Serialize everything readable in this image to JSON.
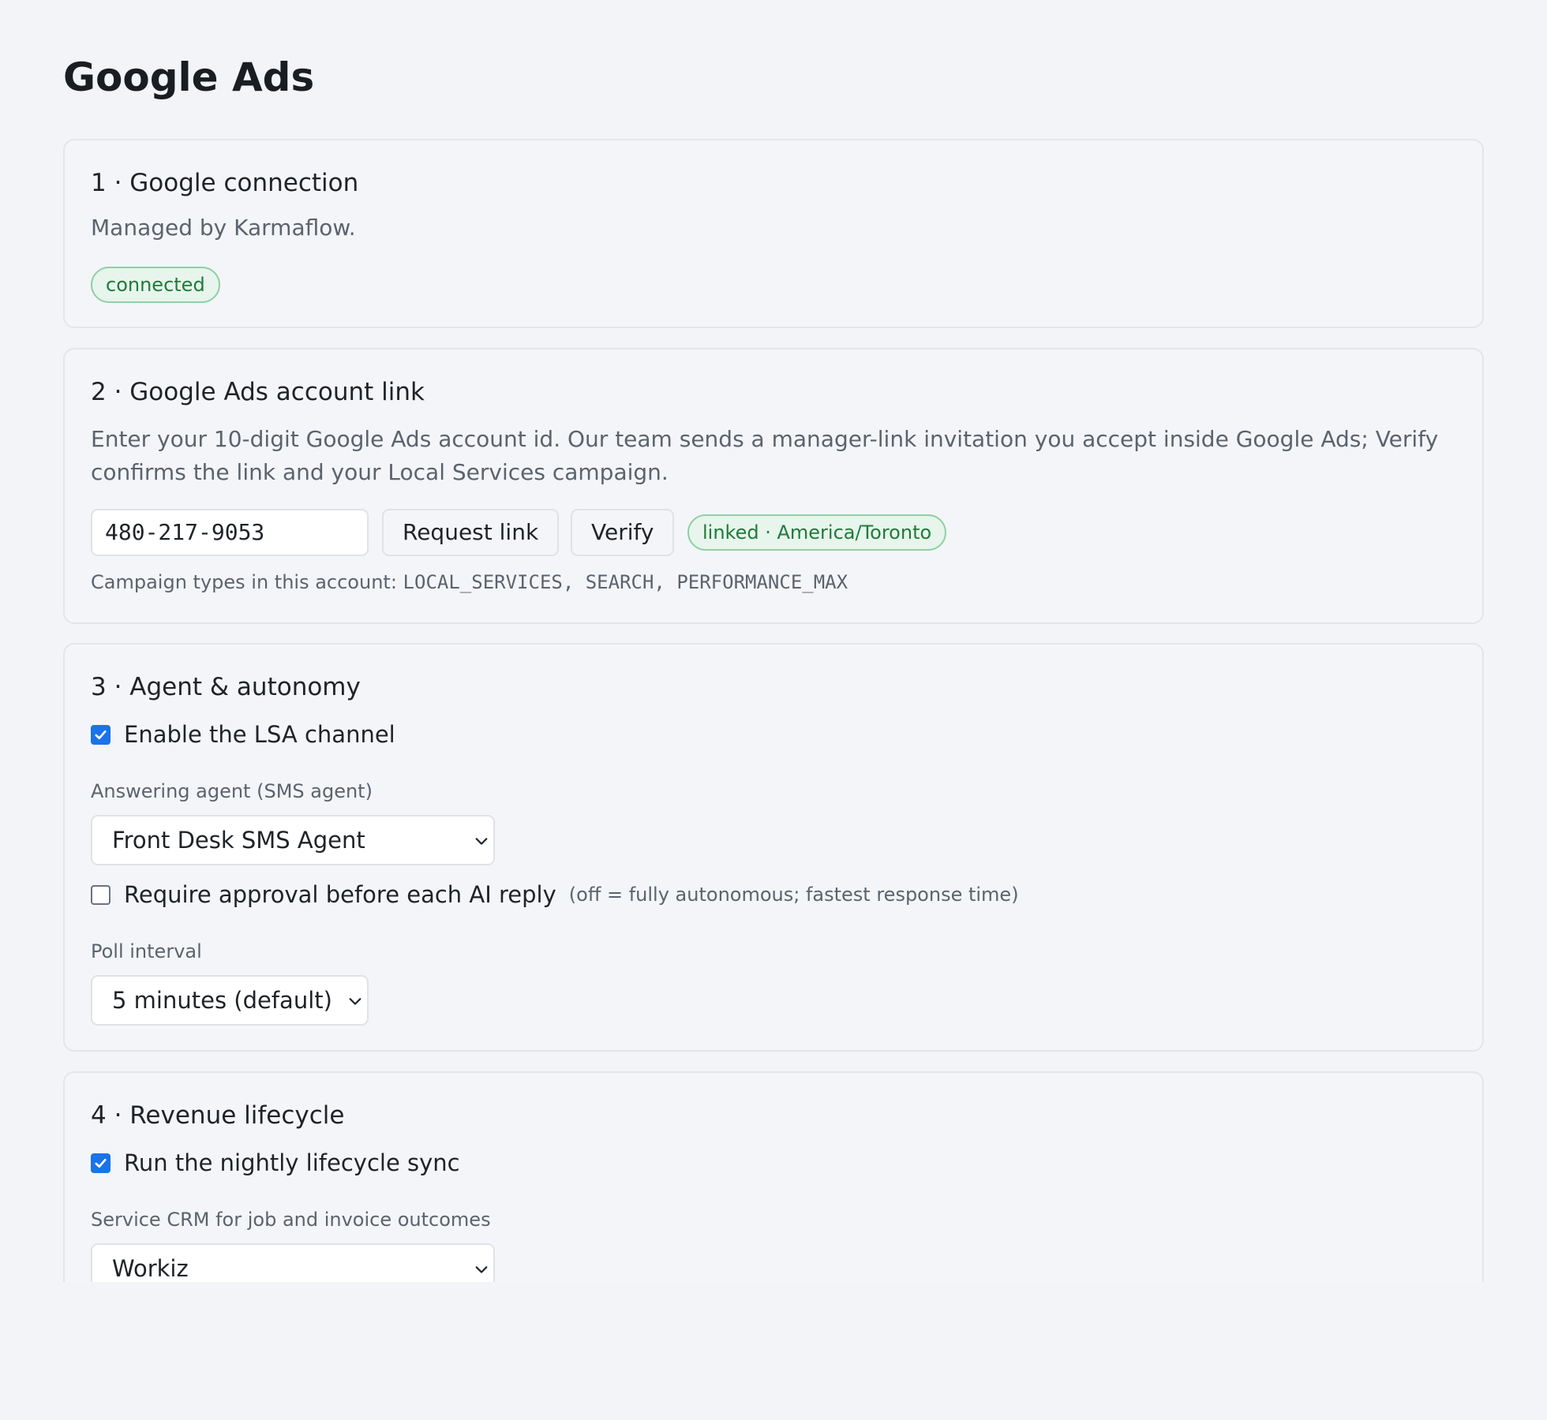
{
  "page": {
    "title": "Google Ads"
  },
  "sections": {
    "connection": {
      "title": "1 · Google connection",
      "description": "Managed by Karmaflow.",
      "status_badge": "connected"
    },
    "account_link": {
      "title": "2 · Google Ads account link",
      "description": "Enter your 10-digit Google Ads account id. Our team sends a manager-link invitation you accept inside Google Ads; Verify confirms the link and your Local Services campaign.",
      "account_id_value": "480-217-9053",
      "request_link_label": "Request link",
      "verify_label": "Verify",
      "status_badge": "linked · America/Toronto",
      "campaign_types_label": "Campaign types in this account:",
      "campaign_types": "LOCAL_SERVICES, SEARCH, PERFORMANCE_MAX"
    },
    "agent": {
      "title": "3 · Agent & autonomy",
      "enable_lsa_label": "Enable the LSA channel",
      "enable_lsa_checked": true,
      "answering_agent_label": "Answering agent (SMS agent)",
      "answering_agent_value": "Front Desk SMS Agent",
      "require_approval_label": "Require approval before each AI reply",
      "require_approval_hint": "(off = fully autonomous; fastest response time)",
      "require_approval_checked": false,
      "poll_interval_label": "Poll interval",
      "poll_interval_value": "5 minutes (default)"
    },
    "revenue": {
      "title": "4 · Revenue lifecycle",
      "nightly_sync_label": "Run the nightly lifecycle sync",
      "nightly_sync_checked": true,
      "crm_label": "Service CRM for job and invoice outcomes",
      "crm_value": "Workiz"
    }
  },
  "colors": {
    "accent": "#1a73e8",
    "success_text": "#1f7a3a",
    "success_bg": "#e7f5ec",
    "success_border": "#8fd0a4"
  }
}
